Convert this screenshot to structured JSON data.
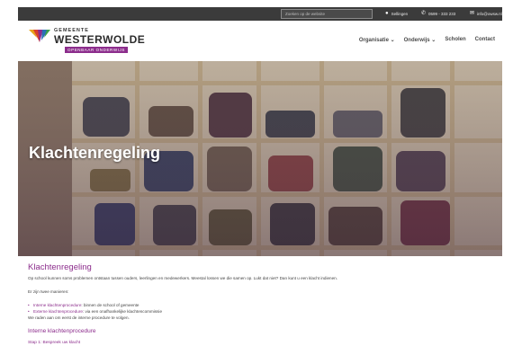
{
  "topbar": {
    "search_placeholder": "Zoeken op de website",
    "location": "Sellingen",
    "phone": "0599 - 333 233",
    "email": "info@owsw.nl"
  },
  "header": {
    "logo_top": "GEMEENTE",
    "logo_main": "WESTERWOLDE",
    "logo_sub": "OPENBAAR ONDERWIJS",
    "nav": [
      "Organisatie ⌄",
      "Onderwijs ⌄",
      "Scholen",
      "Contact"
    ]
  },
  "hero": {
    "title": "Klachtenregeling"
  },
  "content": {
    "heading": "Klachtenregeling",
    "intro": "Op school kunnen soms problemen ontstaan tussen ouders, leerlingen en medewerkers. Meestal lossen we die samen op. Lukt dat niet? Dan kunt u een klacht indienen.",
    "ways": "Er zijn twee manieren:",
    "options": [
      {
        "link": "Interne klachtenprocedure",
        "rest": ": binnen de school of gemeente"
      },
      {
        "link": "Externe klachtenprocedure",
        "rest": ": via een onafhankelijke klachtencommissie"
      }
    ],
    "advice": "We raden aan om eerst de interne procedure te volgen.",
    "sub_heading": "Interne klachtenprocedure",
    "step": "Stap 1: Bespreek uw klacht"
  },
  "colors": {
    "brand_purple": "#8c2d8c",
    "topbar_bg": "#3b3b3b"
  }
}
